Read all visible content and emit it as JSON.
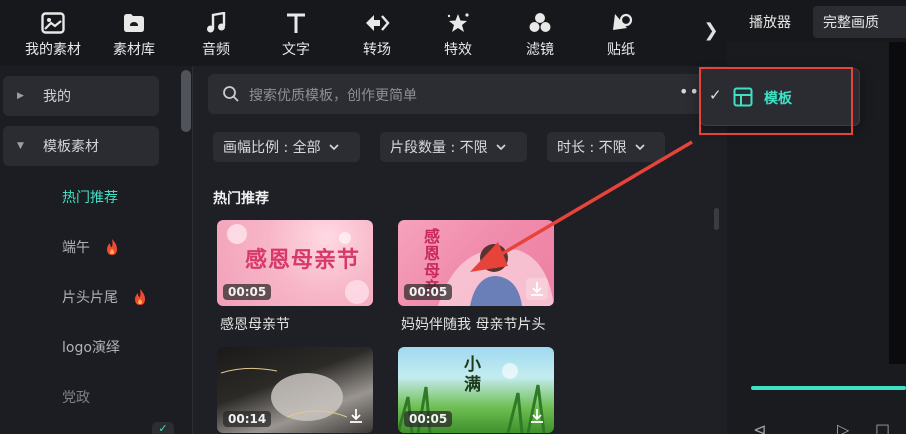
{
  "toolbar": {
    "items": [
      {
        "label": "我的素材",
        "icon": "my-assets-icon"
      },
      {
        "label": "素材库",
        "icon": "library-icon"
      },
      {
        "label": "音频",
        "icon": "music-note-icon"
      },
      {
        "label": "文字",
        "icon": "text-icon"
      },
      {
        "label": "转场",
        "icon": "transition-icon"
      },
      {
        "label": "特效",
        "icon": "effects-icon"
      },
      {
        "label": "滤镜",
        "icon": "filters-icon"
      },
      {
        "label": "贴纸",
        "icon": "sticker-icon"
      }
    ],
    "more_glyph": "❯"
  },
  "sidebar": {
    "groups": [
      {
        "label": "我的",
        "expanded": false
      },
      {
        "label": "模板素材",
        "expanded": true
      }
    ],
    "items": [
      {
        "label": "热门推荐",
        "active": true,
        "hot": false
      },
      {
        "label": "端午",
        "active": false,
        "hot": true
      },
      {
        "label": "片头片尾",
        "active": false,
        "hot": true
      },
      {
        "label": "logo演绎",
        "active": false,
        "hot": false
      },
      {
        "label": "党政",
        "active": false,
        "hot": false
      }
    ],
    "collapse_glyph": "✓"
  },
  "main": {
    "search_placeholder": "搜索优质模板，创作更简单",
    "more_glyph": "•••",
    "filters": [
      {
        "label": "画幅比例 : 全部"
      },
      {
        "label": "片段数量 : 不限"
      },
      {
        "label": "时长 : 不限"
      }
    ],
    "section_title": "热门推荐",
    "cards": [
      {
        "title": "感恩母亲节",
        "duration": "00:05",
        "thumb_text": "感恩母亲节",
        "download": false
      },
      {
        "title": "妈妈伴随我 母亲节片头",
        "duration": "00:05",
        "thumb_text": "感恩母亲",
        "download": true
      },
      {
        "title": "",
        "duration": "00:14",
        "thumb_text": "",
        "download": true
      },
      {
        "title": "",
        "duration": "00:05",
        "thumb_text": "小满",
        "download": true
      }
    ]
  },
  "right_panel": {
    "tabs": [
      "播放器",
      "完整画质"
    ],
    "controls": [
      "⊲",
      "▷",
      "□"
    ]
  },
  "popup": {
    "check_glyph": "✓",
    "label": "模板",
    "icon": "template-layout-icon"
  },
  "colors": {
    "accent": "#3fe0c4",
    "annotation": "#e8433a",
    "background": "#1f2025"
  }
}
